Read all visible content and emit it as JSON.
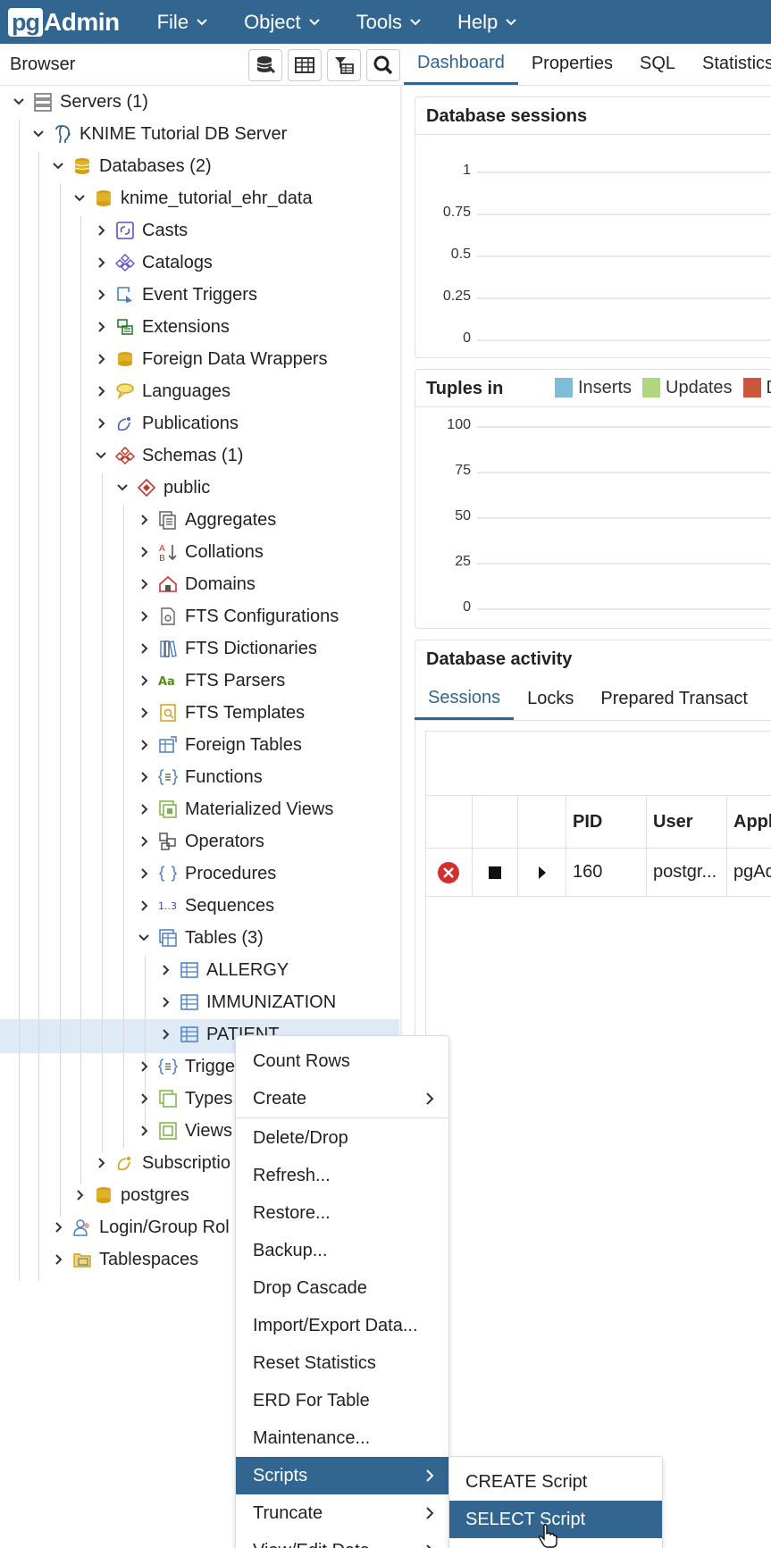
{
  "app": {
    "logo_pg": "pg",
    "logo_admin": "Admin"
  },
  "menu": [
    {
      "label": "File"
    },
    {
      "label": "Object"
    },
    {
      "label": "Tools"
    },
    {
      "label": "Help"
    }
  ],
  "browser": {
    "title": "Browser"
  },
  "tabs": [
    {
      "label": "Dashboard"
    },
    {
      "label": "Properties"
    },
    {
      "label": "SQL"
    },
    {
      "label": "Statistics"
    }
  ],
  "tree": {
    "servers": "Servers (1)",
    "server": "KNIME Tutorial DB Server",
    "databases": "Databases (2)",
    "db": "knime_tutorial_ehr_data",
    "casts": "Casts",
    "catalogs": "Catalogs",
    "event_triggers": "Event Triggers",
    "extensions": "Extensions",
    "fdw": "Foreign Data Wrappers",
    "languages": "Languages",
    "publications": "Publications",
    "schemas": "Schemas (1)",
    "public": "public",
    "aggregates": "Aggregates",
    "collations": "Collations",
    "domains": "Domains",
    "fts_config": "FTS Configurations",
    "fts_dict": "FTS Dictionaries",
    "fts_parsers": "FTS Parsers",
    "fts_templates": "FTS Templates",
    "foreign_tables": "Foreign Tables",
    "functions": "Functions",
    "mat_views": "Materialized Views",
    "operators": "Operators",
    "procedures": "Procedures",
    "sequences": "Sequences",
    "tables": "Tables (3)",
    "allergy": "ALLERGY",
    "immunization": "IMMUNIZATION",
    "patient": "PATIENT",
    "triggers": "Trigge",
    "types": "Types",
    "views": "Views",
    "subscriptions": "Subscriptio",
    "postgres": "postgres",
    "login_roles": "Login/Group Rol",
    "tablespaces": "Tablespaces"
  },
  "dashboard": {
    "sessions_title": "Database sessions",
    "sessions_ticks": [
      "1",
      "0.75",
      "0.5",
      "0.25",
      "0"
    ],
    "tuples_title": "Tuples in",
    "tuples_ticks": [
      "100",
      "75",
      "50",
      "25",
      "0"
    ],
    "legend": [
      {
        "label": "Inserts",
        "color": "#7fbcd6"
      },
      {
        "label": "Updates",
        "color": "#b0d67f"
      },
      {
        "label": "De",
        "color": "#c9573b"
      }
    ],
    "activity_title": "Database activity",
    "activity_tabs": [
      {
        "label": "Sessions"
      },
      {
        "label": "Locks"
      },
      {
        "label": "Prepared Transact"
      }
    ],
    "columns": [
      "PID",
      "User",
      "Appl"
    ],
    "row": {
      "pid": "160",
      "user": "postgr...",
      "app": "pgAd"
    }
  },
  "context_menu": {
    "count_rows": "Count Rows",
    "create": "Create",
    "delete": "Delete/Drop",
    "refresh": "Refresh...",
    "restore": "Restore...",
    "backup": "Backup...",
    "drop_cascade": "Drop Cascade",
    "import_export": "Import/Export Data...",
    "reset_stats": "Reset Statistics",
    "erd": "ERD For Table",
    "maintenance": "Maintenance...",
    "scripts": "Scripts",
    "truncate": "Truncate",
    "view_edit": "View/Edit Data"
  },
  "scripts_submenu": {
    "create_script": "CREATE Script",
    "select_script": "SELECT Script"
  },
  "colors": {
    "brand": "#326690",
    "selection": "#deebf7"
  }
}
